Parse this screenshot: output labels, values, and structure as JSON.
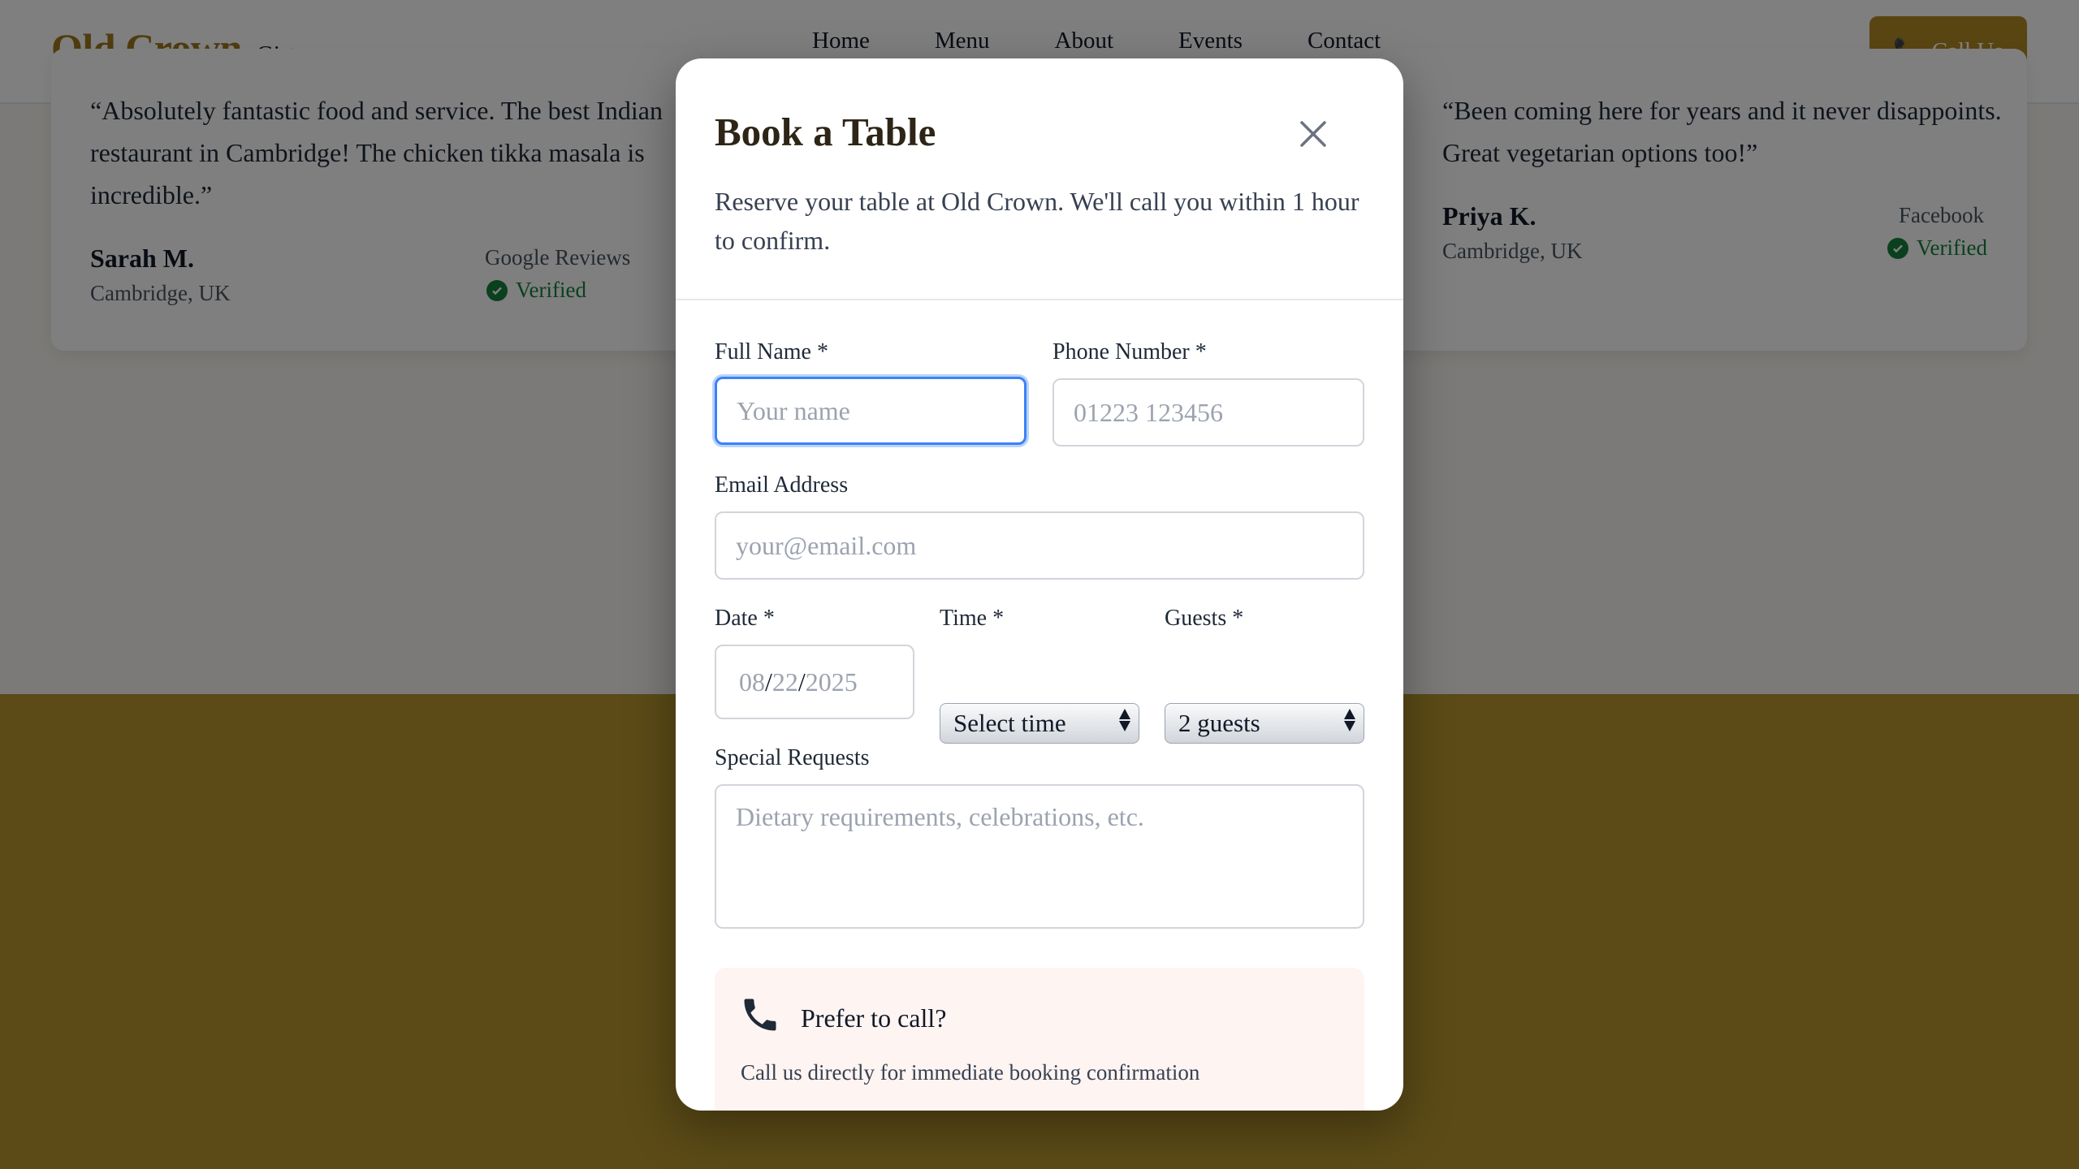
{
  "nav": {
    "brand": "Old Crown",
    "brand_location": "Girton",
    "links": [
      "Home",
      "Menu",
      "About",
      "Events",
      "Contact"
    ],
    "call_button": "Call Us"
  },
  "reviews": [
    {
      "text": "“Absolutely fantastic food and service. The best Indian restaurant in Cambridge! The chicken tikka masala is incredible.”",
      "name": "Sarah M.",
      "location": "Cambridge, UK",
      "source": "Google Reviews",
      "verified": "Verified"
    },
    {
      "text": "“Been coming here for years and it never disappoints. Great vegetarian options too!”",
      "name": "Priya K.",
      "location": "Cambridge, UK",
      "source": "Facebook",
      "verified": "Verified"
    }
  ],
  "modal": {
    "title": "Book a Table",
    "description": "Reserve your table at Old Crown. We'll call you within 1 hour to confirm.",
    "full_name": {
      "label": "Full Name *",
      "placeholder": "Your name",
      "value": ""
    },
    "phone": {
      "label": "Phone Number *",
      "placeholder": "01223 123456",
      "value": ""
    },
    "email": {
      "label": "Email Address",
      "placeholder": "your@email.com",
      "value": ""
    },
    "date": {
      "label": "Date *",
      "month": "08",
      "day": "22",
      "year": "2025"
    },
    "time": {
      "label": "Time *",
      "selected": "Select time"
    },
    "guests": {
      "label": "Guests *",
      "selected": "2 guests"
    },
    "special_requests": {
      "label": "Special Requests",
      "placeholder": "Dietary requirements, celebrations, etc.",
      "value": ""
    },
    "call_box": {
      "title": "Prefer to call?",
      "subtitle": "Call us directly for immediate booking confirmation"
    }
  },
  "colors": {
    "brand_gold": "#a0781e",
    "call_button_bg": "#b28a24",
    "focus_blue": "#3b82f6",
    "verified_green": "#15803d",
    "call_box_bg": "#fef4f2"
  }
}
